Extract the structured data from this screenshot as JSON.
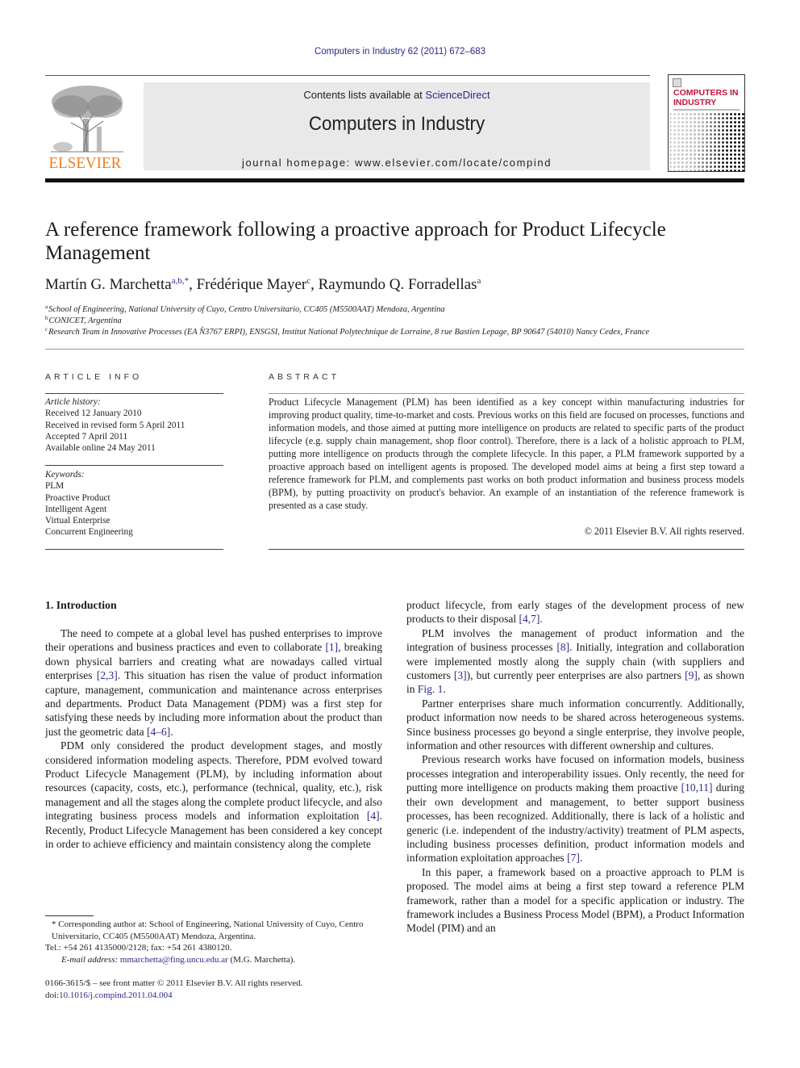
{
  "header": {
    "citation": "Computers in Industry 62 (2011) 672–683",
    "contents_prefix": "Contents lists available at ",
    "contents_link": "ScienceDirect",
    "journal_name": "Computers in Industry",
    "homepage": "journal homepage: www.elsevier.com/locate/compind",
    "publisher_logo": "ELSEVIER",
    "cover_title_line1": "COMPUTERS IN",
    "cover_title_line2": "INDUSTRY"
  },
  "article": {
    "title": "A reference framework following a proactive approach for Product Lifecycle Management",
    "authors": [
      {
        "name": "Martín G. Marchetta",
        "sup": "a,b,*"
      },
      {
        "name": "Frédérique Mayer",
        "sup": "c"
      },
      {
        "name": "Raymundo Q. Forradellas",
        "sup": "a"
      }
    ],
    "affiliations": [
      {
        "key": "a",
        "text": "School of Engineering, National University of Cuyo, Centro Universitario, CC405 (M5500AAT) Mendoza, Argentina"
      },
      {
        "key": "b",
        "text": "CONICET, Argentina"
      },
      {
        "key": "c",
        "text": "Research Team in Innovative Processes (EA N̊3767 ERPI), ENSGSI, Institut National Polytechnique de Lorraine, 8 rue Bastien Lepage, BP 90647 (54010) Nancy Cedex, France"
      }
    ]
  },
  "article_info": {
    "heading": "ARTICLE INFO",
    "history_label": "Article history:",
    "history": [
      "Received 12 January 2010",
      "Received in revised form 5 April 2011",
      "Accepted 7 April 2011",
      "Available online 24 May 2011"
    ],
    "keywords_label": "Keywords:",
    "keywords": [
      "PLM",
      "Proactive Product",
      "Intelligent Agent",
      "Virtual Enterprise",
      "Concurrent Engineering"
    ]
  },
  "abstract": {
    "heading": "ABSTRACT",
    "text": "Product Lifecycle Management (PLM) has been identified as a key concept within manufacturing industries for improving product quality, time-to-market and costs. Previous works on this field are focused on processes, functions and information models, and those aimed at putting more intelligence on products are related to specific parts of the product lifecycle (e.g. supply chain management, shop floor control). Therefore, there is a lack of a holistic approach to PLM, putting more intelligence on products through the complete lifecycle. In this paper, a PLM framework supported by a proactive approach based on intelligent agents is proposed. The developed model aims at being a first step toward a reference framework for PLM, and complements past works on both product information and business process models (BPM), by putting proactivity on product's behavior. An example of an instantiation of the reference framework is presented as a case study.",
    "copyright": "© 2011 Elsevier B.V. All rights reserved."
  },
  "body": {
    "section_heading": "1.  Introduction",
    "left_paragraphs": [
      [
        {
          "t": "The need to compete at a global level has pushed enterprises to improve their operations and business practices and even to collaborate "
        },
        {
          "ref": "[1]"
        },
        {
          "t": ", breaking down physical barriers and creating what are nowadays called virtual enterprises "
        },
        {
          "ref": "[2,3]"
        },
        {
          "t": ". This situation has risen the value of product information capture, management, communication and maintenance across enterprises and departments. Product Data Management (PDM) was a first step for satisfying these needs by including more information about the product than just the geometric data "
        },
        {
          "ref": "[4–6]"
        },
        {
          "t": "."
        }
      ],
      [
        {
          "t": "PDM only considered the product development stages, and mostly considered information modeling aspects. Therefore, PDM evolved toward Product Lifecycle Management (PLM), by including information about resources (capacity, costs, etc.), performance (technical, quality, etc.), risk management and all the stages along the complete product lifecycle, and also integrating business process models and information exploitation "
        },
        {
          "ref": "[4]"
        },
        {
          "t": ". Recently, Product Lifecycle Management has been considered a key concept in order to achieve efficiency and maintain consistency along the complete"
        }
      ]
    ],
    "right_paragraphs": [
      [
        {
          "t": "product lifecycle, from early stages of the development process of new products to their disposal "
        },
        {
          "ref": "[4,7]"
        },
        {
          "t": "."
        }
      ],
      [
        {
          "t": "PLM involves the management of product information and the integration of business processes "
        },
        {
          "ref": "[8]"
        },
        {
          "t": ". Initially, integration and collaboration were implemented mostly along the supply chain (with suppliers and customers "
        },
        {
          "ref": "[3]"
        },
        {
          "t": "), but currently peer enterprises are also partners "
        },
        {
          "ref": "[9]"
        },
        {
          "t": ", as shown in "
        },
        {
          "ref": "Fig. 1"
        },
        {
          "t": "."
        }
      ],
      [
        {
          "t": "Partner enterprises share much information concurrently. Additionally, product information now needs to be shared across heterogeneous systems. Since business processes go beyond a single enterprise, they involve people, information and other resources with different ownership and cultures."
        }
      ],
      [
        {
          "t": "Previous research works have focused on information models, business processes integration and interoperability issues. Only recently, the need for putting more intelligence on products making them proactive "
        },
        {
          "ref": "[10,11]"
        },
        {
          "t": " during their own development and management, to better support business processes, has been recognized. Additionally, there is lack of a holistic and generic (i.e. independent of the industry/activity) treatment of PLM aspects, including business processes definition, product information models and information exploitation approaches "
        },
        {
          "ref": "[7]"
        },
        {
          "t": "."
        }
      ],
      [
        {
          "t": "In this paper, a framework based on a proactive approach to PLM is proposed. The model aims at being a first step toward a reference PLM framework, rather than a model for a specific application or industry. The framework includes a Business Process Model (BPM), a Product Information Model (PIM) and an"
        }
      ]
    ]
  },
  "footnote": {
    "corresponding": "* Corresponding author at: School of Engineering, National University of Cuyo, Centro Universitario, CC405 (M5500AAT) Mendoza, Argentina.",
    "tel": "Tel.: +54 261 4135000/2128; fax: +54 261 4380120.",
    "email_label": "E-mail address:",
    "email": "mmarchetta@fing.uncu.edu.ar",
    "email_suffix": " (M.G. Marchetta).",
    "front_matter": "0166-3615/$ – see front matter © 2011 Elsevier B.V. All rights reserved.",
    "doi_prefix": "doi:",
    "doi": "10.1016/j.compind.2011.04.004"
  },
  "colors": {
    "link": "#2a2a8a",
    "elsevier_orange": "#f07d1e",
    "cover_red": "#c0143c",
    "masthead_bg": "#e9e9e9"
  }
}
